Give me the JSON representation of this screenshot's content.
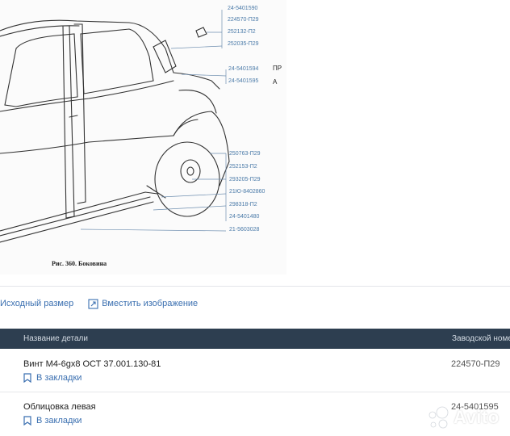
{
  "diagram": {
    "callouts": [
      "24-5401590",
      "224570-П29",
      "252132-П2",
      "252035-П29",
      "24-5401594",
      "24-5401595",
      "250763-П29",
      "252153-П2",
      "293205-П29",
      "21Ю-8402860",
      "298318-П2",
      "24-5401480",
      "21-5603028"
    ],
    "caption": "Рис. 360. Боковина",
    "side_text_1": "ПР",
    "side_text_2": "А"
  },
  "toolbar": {
    "original_size_label": "Исходный размер",
    "fit_image_label": "Вместить изображение"
  },
  "table": {
    "headers": {
      "name": "Название детали",
      "factory_number": "Заводской номе"
    },
    "rows": [
      {
        "name": "Винт М4-6gx8 ОСТ 37.001.130-81",
        "number": "224570-П29",
        "bookmark": "В закладки"
      },
      {
        "name": "Облицовка левая",
        "number": "24-5401595",
        "bookmark": "В закладки"
      }
    ]
  },
  "watermark": {
    "text": "Avito"
  },
  "colors": {
    "link": "#3a6fb0",
    "header_bg": "#2d3e50",
    "callout": "#4a7aa8"
  }
}
